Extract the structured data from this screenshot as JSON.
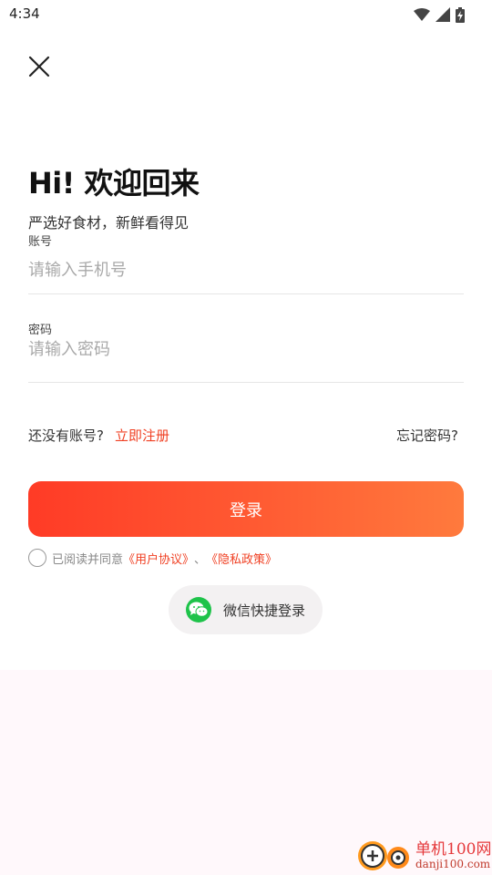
{
  "status_bar": {
    "time": "4:34",
    "icons": [
      "wifi-icon",
      "signal-icon",
      "battery-charging-icon"
    ]
  },
  "header": {
    "close_icon": "close-icon",
    "title": "Hi! 欢迎回来",
    "subtitle": "严选好食材，新鲜看得见"
  },
  "form": {
    "account_label": "账号",
    "account_placeholder": "请输入手机号",
    "password_label": "密码",
    "password_placeholder": "请输入密码"
  },
  "links": {
    "no_account": "还没有账号?",
    "register": "立即注册",
    "forgot_password": "忘记密码?"
  },
  "login_button": "登录",
  "agreement": {
    "prefix": "已阅读并同意",
    "user_agreement": "《用户协议》",
    "separator": "、",
    "privacy_policy": "《隐私政策》"
  },
  "wechat_login": {
    "icon": "wechat-icon",
    "label": "微信快捷登录"
  },
  "watermark": {
    "name": "单机100网",
    "url": "danji100.com"
  },
  "colors": {
    "accent": "#f04023",
    "button_start": "#ff3b26",
    "button_end": "#ff7a3d",
    "wechat_green": "#1ec34a"
  }
}
